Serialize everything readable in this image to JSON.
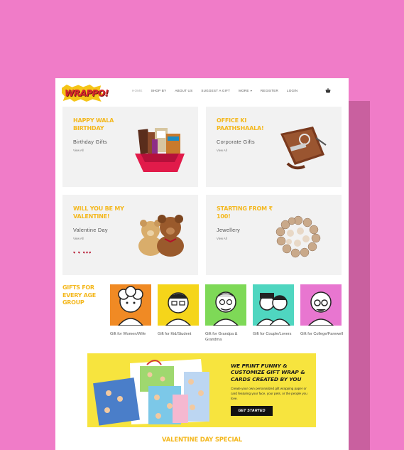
{
  "brand": {
    "logo_text": "WRAPPO!"
  },
  "nav": {
    "items": [
      {
        "label": "Home",
        "active": true
      },
      {
        "label": "Shop By",
        "active": false
      },
      {
        "label": "About Us",
        "active": false
      },
      {
        "label": "Suggest A Gift",
        "active": false
      },
      {
        "label": "More",
        "active": false
      },
      {
        "label": "Register",
        "active": false
      },
      {
        "label": "Login",
        "active": false
      }
    ],
    "cart_icon": "basket-icon"
  },
  "categories": [
    {
      "title": "HAPPY WALA BIRTHDAY",
      "subtitle": "Birthday Gifts",
      "link": "View All"
    },
    {
      "title": "OFFICE KI PAATHSHAALA!",
      "subtitle": "Corporate Gifts",
      "link": "View All"
    },
    {
      "title": "WILL YOU BE MY VALENTINE!",
      "subtitle": "Valentine Day",
      "link": "View All",
      "decor": "♥ ♥ ♥♥♥"
    },
    {
      "title": "STARTING FROM ₹ 100!",
      "subtitle": "Jewellery",
      "link": "View All"
    }
  ],
  "age_groups": {
    "title": "GIFTS FOR EVERY AGE GROUP",
    "items": [
      {
        "label": "Gift for Women/Wife",
        "color": "#f08a24"
      },
      {
        "label": "Gift for Kid/Student",
        "color": "#f5d51a"
      },
      {
        "label": "Gift for Grandpa & Grandma",
        "color": "#7ed957"
      },
      {
        "label": "Gift for Couple/Lovers",
        "color": "#4fd6c0"
      },
      {
        "label": "Gift for College/Farewell",
        "color": "#e876d0"
      }
    ]
  },
  "banner": {
    "headline": "WE PRINT FUNNY & CUSTOMIZE GIFT WRAP & CARDS CREATED BY YOU",
    "description": "Create your own personalized gift wrapping paper or card featuring your face, your pets, or the people you love.",
    "button": "GET STARTED"
  },
  "section": {
    "title": "VALENTINE DAY SPECIAL"
  },
  "colors": {
    "background": "#f07cc8",
    "accent_yellow": "#f4b81e",
    "card_bg": "#f2f2f2",
    "banner_bg": "#f7e43e"
  }
}
